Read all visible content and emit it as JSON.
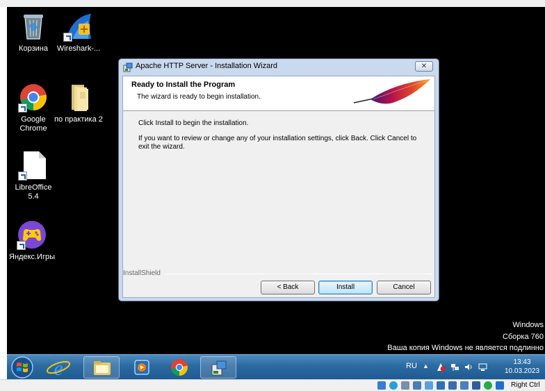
{
  "desktop": {
    "icons": [
      {
        "label": "Корзина"
      },
      {
        "label": "Wireshark-..."
      },
      {
        "label": "Google Chrome"
      },
      {
        "label": "по практика 2"
      },
      {
        "label": "LibreOffice 5.4"
      },
      {
        "label": "Яндекс.Игры"
      }
    ],
    "activation": {
      "line1": "Windows",
      "line2": "Сборка 760",
      "line3": "Ваша копия Windows не является подлинно"
    }
  },
  "dialog": {
    "title": "Apache HTTP Server - Installation Wizard",
    "close_glyph": "✕",
    "heading": "Ready to Install the Program",
    "subheading": "The wizard is ready to begin installation.",
    "paragraph1": "Click Install to begin the installation.",
    "paragraph2": "If you want to review or change any of your installation settings, click Back. Click Cancel to exit the wizard.",
    "installshield_label": "InstallShield",
    "back_label": "< Back",
    "install_label": "Install",
    "cancel_label": "Cancel"
  },
  "taskbar": {
    "pinned": [
      "internet-explorer",
      "explorer",
      "media-player",
      "chrome",
      "installer"
    ],
    "tray": {
      "language": "RU",
      "chevron": "▲",
      "time": "13:43",
      "date": "10.03.2023"
    }
  },
  "vbox_status": {
    "host_key_label": "Right Ctrl"
  },
  "colors": {
    "desktop_bg": "#000000",
    "taskbar": "#2c6aa0",
    "dialog_frame": "#c9d9ee",
    "default_button": "#bfe3f8"
  }
}
